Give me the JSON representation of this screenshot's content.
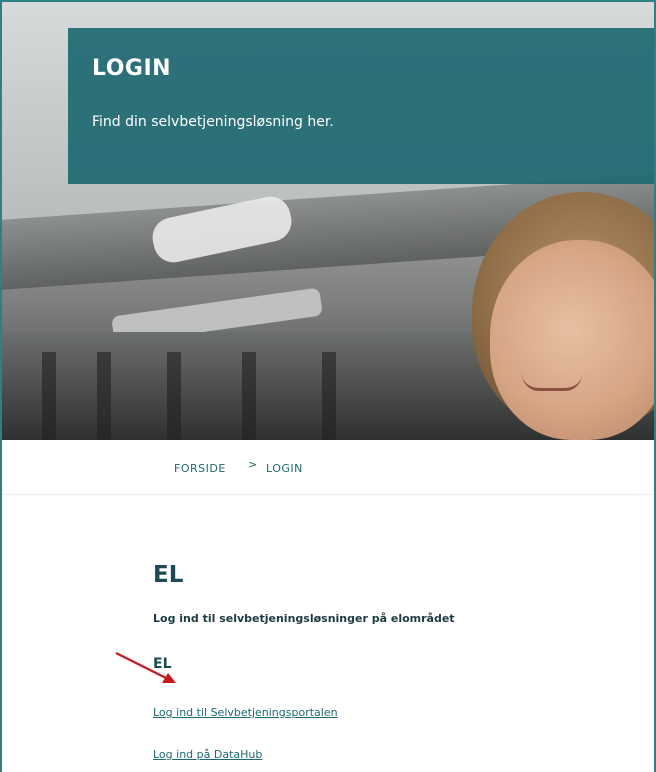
{
  "hero": {
    "title": "LOGIN",
    "subtitle": "Find din selvbetjeningsløsning her."
  },
  "breadcrumb": {
    "home": "FORSIDE",
    "separator": ">",
    "current": "LOGIN"
  },
  "section": {
    "title": "EL",
    "description": "Log ind til selvbetjeningsløsninger på elområdet",
    "subtitle": "EL",
    "links": [
      "Log ind til Selvbetjeningsportalen",
      "Log ind på DataHub"
    ]
  },
  "colors": {
    "accent": "#1e6a71",
    "banner": "#1e6871",
    "arrow": "#c8181e"
  },
  "icons": {
    "annotation": "red-arrow-icon",
    "separator": "chevron-right-icon"
  }
}
